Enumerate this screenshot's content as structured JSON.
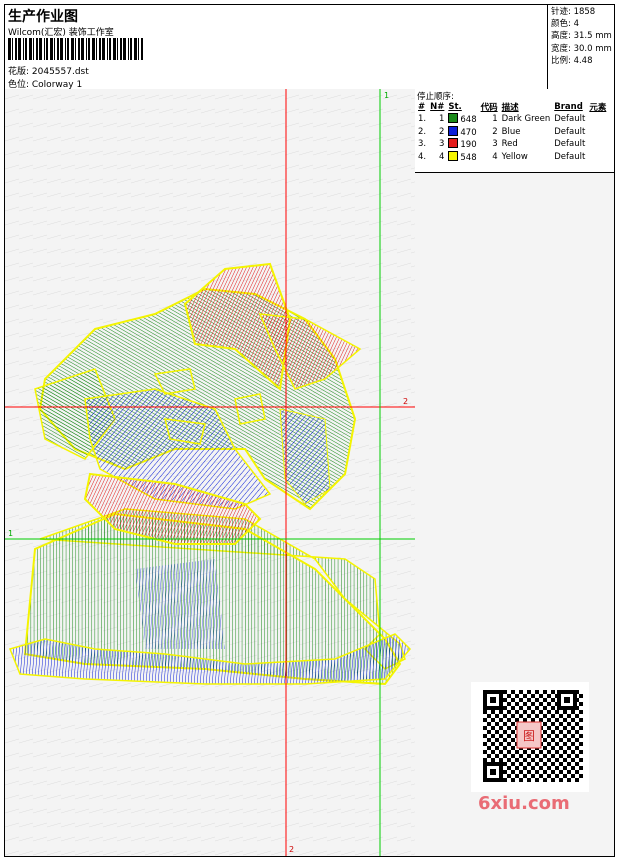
{
  "header": {
    "title": "生产作业图",
    "subtitle": "Wilcom(汇宏) 装饰工作室",
    "pattern_label": "花版: 2045557.dst",
    "colorway_label": "色位: Colorway 1"
  },
  "stats": {
    "stitches": "针迹: 1858",
    "colors": "颜色: 4",
    "height": "高度: 31.5 mm",
    "width": "宽度: 30.0 mm",
    "ratio": "比例: 4.48"
  },
  "axes": {
    "top_v": "1",
    "mid_h": "2",
    "left_h": "1",
    "bottom_v": "2"
  },
  "stop_sequence": {
    "title": "停止顺序:",
    "columns": [
      "#",
      "N#",
      "St.",
      "代码",
      "描述",
      "Brand",
      "元素"
    ],
    "rows": [
      {
        "idx": "1.",
        "n": "1",
        "st": "648",
        "code": "1",
        "desc": "Dark Green",
        "brand": "Default",
        "color": "#1a8a1a"
      },
      {
        "idx": "2.",
        "n": "2",
        "st": "470",
        "code": "2",
        "desc": "Blue",
        "brand": "Default",
        "color": "#0b1fd9"
      },
      {
        "idx": "3.",
        "n": "3",
        "st": "190",
        "code": "3",
        "desc": "Red",
        "brand": "Default",
        "color": "#e41b1b"
      },
      {
        "idx": "4.",
        "n": "4",
        "st": "548",
        "code": "4",
        "desc": "Yellow",
        "brand": "Default",
        "color": "#f4f400"
      }
    ]
  },
  "watermark": "6xiu.com",
  "qr_stamp": "图"
}
